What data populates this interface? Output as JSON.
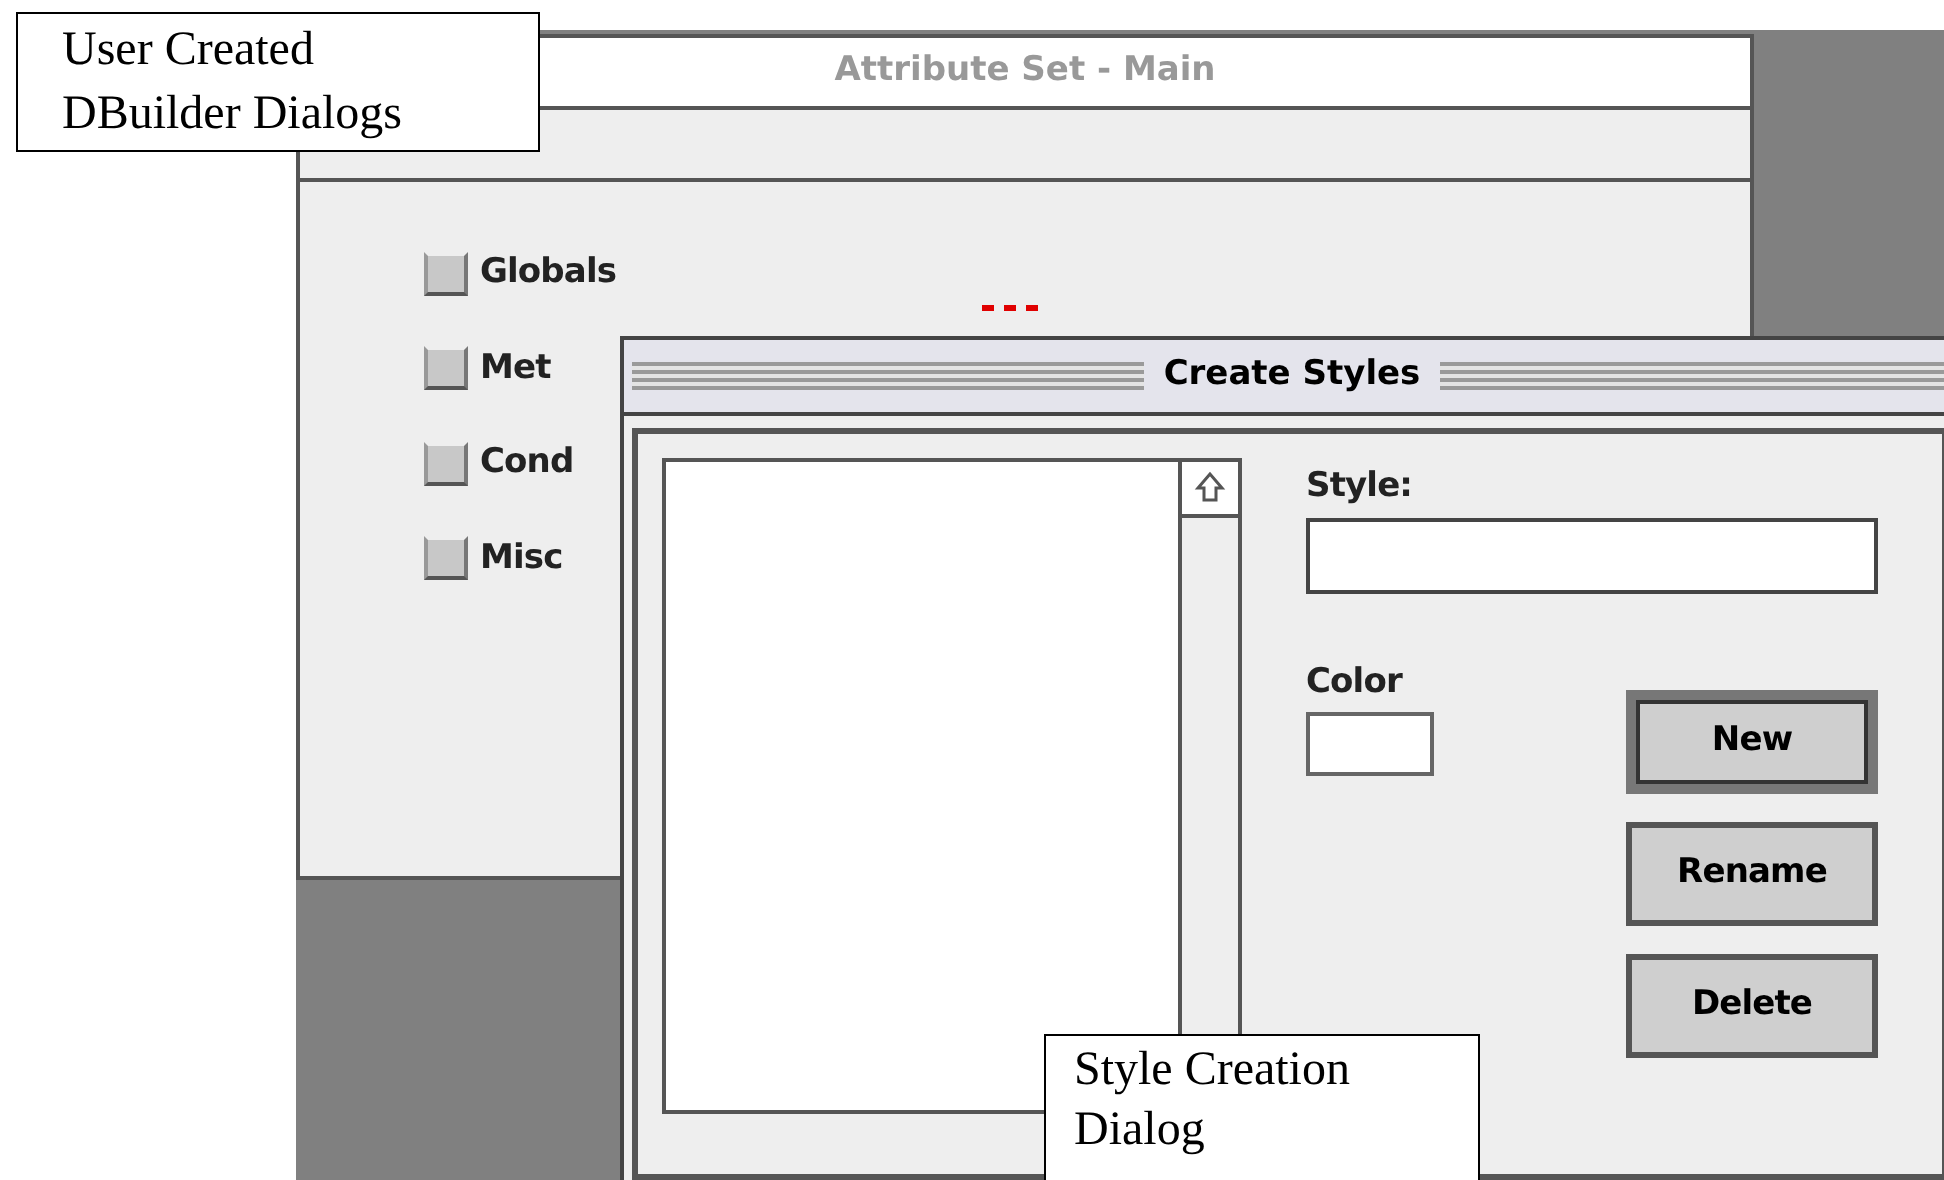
{
  "attribute_window": {
    "title": "Attribute Set - Main",
    "active": false,
    "checkboxes": [
      {
        "label": "Globals",
        "checked": false
      },
      {
        "label": "Met",
        "checked": false
      },
      {
        "label": "Cond",
        "checked": false
      },
      {
        "label": "Misc",
        "checked": false
      }
    ]
  },
  "styles_window": {
    "title": "Create Styles",
    "active": true,
    "style_label": "Style:",
    "color_label": "Color",
    "buttons": [
      {
        "label": "New",
        "default": true
      },
      {
        "label": "Rename",
        "default": false
      },
      {
        "label": "Delete",
        "default": false
      }
    ]
  },
  "annotations": [
    {
      "text": "User Created\nDBuilder Dialogs"
    },
    {
      "text": "Style Creation\nDialog"
    }
  ]
}
